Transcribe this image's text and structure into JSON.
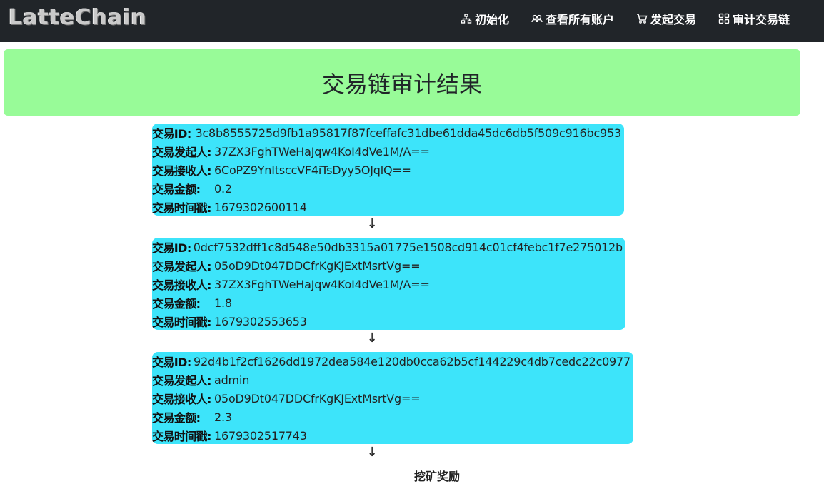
{
  "navbar": {
    "brand": "LatteChain",
    "items": [
      {
        "label": "初始化",
        "icon": "sitemap-icon"
      },
      {
        "label": "查看所有账户",
        "icon": "people-icon"
      },
      {
        "label": "发起交易",
        "icon": "cart-icon"
      },
      {
        "label": "审计交易链",
        "icon": "grid-icon"
      }
    ]
  },
  "hero": {
    "title": "交易链审计结果",
    "color": "#98fb98"
  },
  "labels": {
    "id": "交易ID:",
    "sender": "交易发起人:",
    "receiver": "交易接收人:",
    "amount": "交易金额:",
    "timestamp": "交易时间戳:"
  },
  "transactions": [
    {
      "id": "3c8b8555725d9fb1a95817f87fceffafc31dbe61dda45dc6db5f509c916bc953",
      "sender": "37ZX3FghTWeHaJqw4KoI4dVe1M/A==",
      "receiver": "6CoPZ9YnItsccVF4iTsDyy5OJqlQ==",
      "amount": "0.2",
      "timestamp": "1679302600114"
    },
    {
      "id": "0dcf7532dff1c8d548e50db3315a01775e1508cd914c01cf4febc1f7e275012b",
      "sender": "05oD9Dt047DDCfrKgKJExtMsrtVg==",
      "receiver": "37ZX3FghTWeHaJqw4KoI4dVe1M/A==",
      "amount": "1.8",
      "timestamp": "1679302553653"
    },
    {
      "id": "92d4b1f2cf1626dd1972dea584e120db0cca62b5cf144229c4db7cedc22c0977",
      "sender": "admin",
      "receiver": "05oD9Dt047DDCfrKgKJExtMsrtVg==",
      "amount": "2.3",
      "timestamp": "1679302517743"
    }
  ],
  "arrow": "↓",
  "footer": {
    "mining_label": "挖矿奖励"
  },
  "colors": {
    "navbar": "#212529",
    "card": "#3de4fa"
  }
}
